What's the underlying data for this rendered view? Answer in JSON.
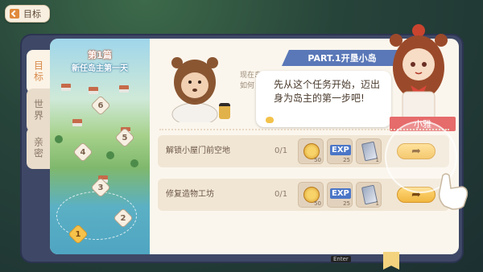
{
  "header": {
    "back_label": "目标"
  },
  "side_tabs": [
    {
      "label": "目标",
      "active": true
    },
    {
      "label": "世界",
      "active": false
    },
    {
      "label": "亲密",
      "active": false
    }
  ],
  "map": {
    "chapter_title": "第1篇",
    "chapter_subtitle": "新任岛主第一天",
    "nodes": [
      "6",
      "5",
      "4",
      "3",
      "2",
      "1"
    ],
    "current_node": "1"
  },
  "quest": {
    "part_title": "PART.1开垦小岛",
    "intro_text_line1": "现在岛",
    "intro_text_line2": "如何"
  },
  "dialogue": {
    "text": "先从这个任务开始，迈出身为岛主的第一步吧!",
    "speaker": "小雅"
  },
  "tasks": [
    {
      "name": "解锁小屋门前空地",
      "progress": "0/1",
      "rewards": [
        {
          "icon": "coin-icon",
          "amount": "50"
        },
        {
          "icon": "exp-icon",
          "label": "EXP",
          "amount": "25"
        },
        {
          "icon": "ticket-icon",
          "amount": "1"
        }
      ]
    },
    {
      "name": "修复造物工坊",
      "progress": "0/1",
      "rewards": [
        {
          "icon": "coin-icon",
          "amount": "50"
        },
        {
          "icon": "exp-icon",
          "label": "EXP",
          "amount": "25"
        },
        {
          "icon": "ticket-icon",
          "amount": "1"
        }
      ]
    }
  ],
  "footer": {
    "enter_hint": "Enter"
  },
  "colors": {
    "accent": "#f1b640",
    "banner": "#5a78b8",
    "name_tag": "#e66b6b"
  }
}
